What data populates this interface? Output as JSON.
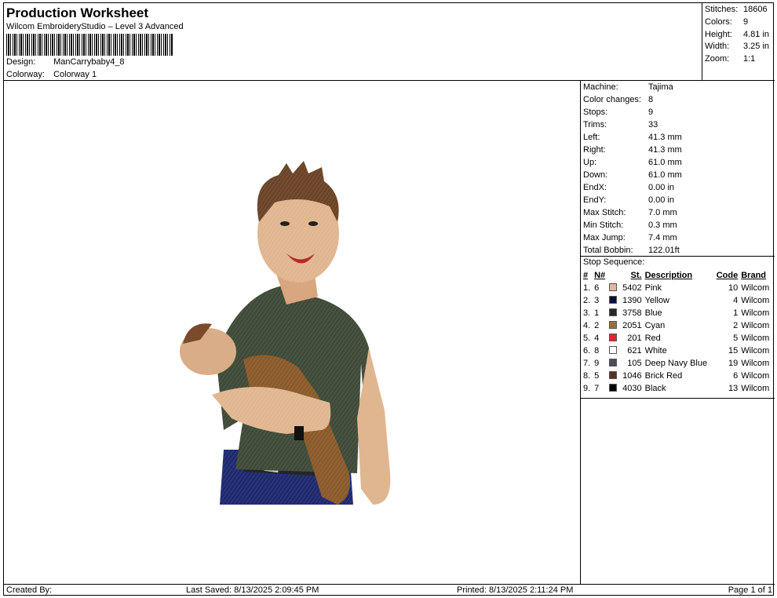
{
  "header": {
    "title": "Production Worksheet",
    "subtitle": "Wilcom EmbroideryStudio – Level 3 Advanced",
    "design_label": "Design:",
    "design_value": "ManCarrybaby4_8",
    "colorway_label": "Colorway:",
    "colorway_value": "Colorway 1"
  },
  "stats": [
    {
      "label": "Stitches:",
      "value": "18606"
    },
    {
      "label": "Colors:",
      "value": "9"
    },
    {
      "label": "Height:",
      "value": "4.81 in"
    },
    {
      "label": "Width:",
      "value": "3.25 in"
    },
    {
      "label": "Zoom:",
      "value": "1:1"
    }
  ],
  "machine_info": [
    {
      "label": "Machine:",
      "value": "Tajima"
    },
    {
      "label": "Color changes:",
      "value": "8"
    },
    {
      "label": "Stops:",
      "value": "9"
    },
    {
      "label": "Trims:",
      "value": "33"
    },
    {
      "label": "Left:",
      "value": "41.3 mm"
    },
    {
      "label": "Right:",
      "value": "41.3 mm"
    },
    {
      "label": "Up:",
      "value": "61.0 mm"
    },
    {
      "label": "Down:",
      "value": "61.0 mm"
    },
    {
      "label": "EndX:",
      "value": "0.00 in"
    },
    {
      "label": "EndY:",
      "value": "0.00 in"
    },
    {
      "label": "Max Stitch:",
      "value": "7.0 mm"
    },
    {
      "label": "Min Stitch:",
      "value": "0.3 mm"
    },
    {
      "label": "Max Jump:",
      "value": "7.4 mm"
    },
    {
      "label": "Total Bobbin:",
      "value": "122.01ft"
    }
  ],
  "stop_sequence": {
    "title": "Stop Sequence:",
    "columns": [
      "#",
      "N#",
      "St.",
      "Description",
      "Code",
      "Brand"
    ],
    "rows": [
      {
        "num": "1.",
        "n": "6",
        "color": "#e8b49a",
        "st": "5402",
        "desc": "Pink",
        "code": "10",
        "brand": "Wilcom"
      },
      {
        "num": "2.",
        "n": "3",
        "color": "#0a0f3c",
        "st": "1390",
        "desc": "Yellow",
        "code": "4",
        "brand": "Wilcom"
      },
      {
        "num": "3.",
        "n": "1",
        "color": "#262a22",
        "st": "3758",
        "desc": "Blue",
        "code": "1",
        "brand": "Wilcom"
      },
      {
        "num": "4.",
        "n": "2",
        "color": "#9c6e36",
        "st": "2051",
        "desc": "Cyan",
        "code": "2",
        "brand": "Wilcom"
      },
      {
        "num": "5.",
        "n": "4",
        "color": "#e2262c",
        "st": "201",
        "desc": "Red",
        "code": "5",
        "brand": "Wilcom"
      },
      {
        "num": "6.",
        "n": "8",
        "color": "#ffffff",
        "st": "621",
        "desc": "White",
        "code": "15",
        "brand": "Wilcom"
      },
      {
        "num": "7.",
        "n": "9",
        "color": "#4a4e5c",
        "st": "105",
        "desc": "Deep Navy Blue",
        "code": "19",
        "brand": "Wilcom"
      },
      {
        "num": "8.",
        "n": "5",
        "color": "#5a3026",
        "st": "1046",
        "desc": "Brick Red",
        "code": "6",
        "brand": "Wilcom"
      },
      {
        "num": "9.",
        "n": "7",
        "color": "#000000",
        "st": "4030",
        "desc": "Black",
        "code": "13",
        "brand": "Wilcom"
      }
    ]
  },
  "footer": {
    "created_by": "Created By:",
    "last_saved": "Last Saved: 8/13/2025 2:09:45 PM",
    "printed": "Printed: 8/13/2025 2:11:24 PM",
    "page": "Page 1 of 1"
  }
}
